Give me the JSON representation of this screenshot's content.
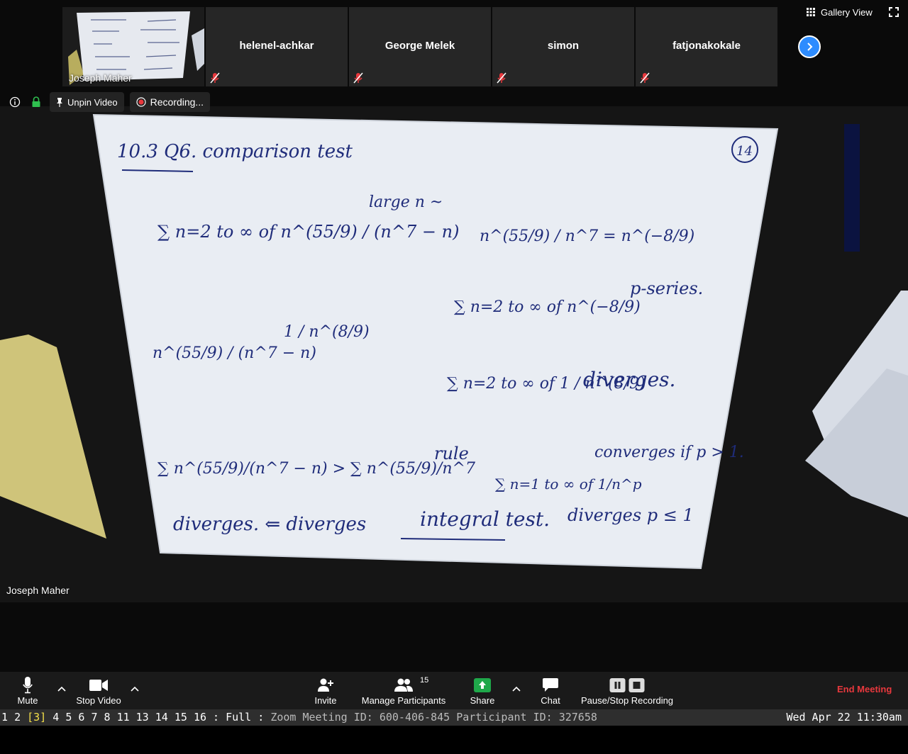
{
  "gallery": {
    "self_name": "Joseph Maher",
    "tiles": [
      {
        "name": "helenel-achkar",
        "muted": true
      },
      {
        "name": "George Melek",
        "muted": true
      },
      {
        "name": "simon",
        "muted": true
      },
      {
        "name": "fatjonakokale",
        "muted": true
      }
    ],
    "view_label": "Gallery View"
  },
  "info_bar": {
    "unpin_label": "Unpin Video",
    "recording_label": "Recording..."
  },
  "speaker": {
    "name": "Joseph Maher"
  },
  "whiteboard": {
    "title": "10.3 Q6. comparison test",
    "page_number": "14",
    "lines": [
      "∑ n=2 to ∞ of n^(55/9) / (n^7 − n)",
      "large n ~",
      "n^(55/9) / n^7 = n^(−8/9)",
      "∑ n=2 to ∞ of n^(−8/9)",
      "p-series.",
      "n^(55/9) / (n^7 − n)",
      "1 / n^(8/9)",
      "∑ n=2 to ∞ of 1 / n^(8/9)",
      "diverges.",
      "∑ n^(55/9)/(n^7 − n) > ∑ n^(55/9)/n^7",
      "rule",
      "∑ n=1 to ∞ of 1/n^p",
      "converges if p > 1.",
      "diverges. ⇐ diverges",
      "integral test.",
      "diverges p ≤ 1"
    ]
  },
  "toolbar": {
    "mute_label": "Mute",
    "stop_video_label": "Stop Video",
    "invite_label": "Invite",
    "manage_participants_label": "Manage Participants",
    "participants_count": "15",
    "share_label": "Share",
    "chat_label": "Chat",
    "pause_stop_label": "Pause/Stop Recording",
    "end_meeting_label": "End Meeting"
  },
  "status_bar": {
    "workspaces": [
      "1",
      "2",
      "3",
      "4",
      "5",
      "6",
      "7",
      "8",
      "11",
      "13",
      "14",
      "15",
      "16"
    ],
    "active_workspace": "3",
    "mode": "Full",
    "window_title": "Zoom Meeting ID: 600-406-845 Participant ID: 327658",
    "datetime": "Wed Apr 22 11:30am"
  },
  "colors": {
    "accent_blue": "#2d8cff",
    "end_meeting_red": "#e8383d",
    "share_green": "#1fa84a",
    "active_workspace": "#f5e04a",
    "ink_blue": "#1f2c7a"
  }
}
